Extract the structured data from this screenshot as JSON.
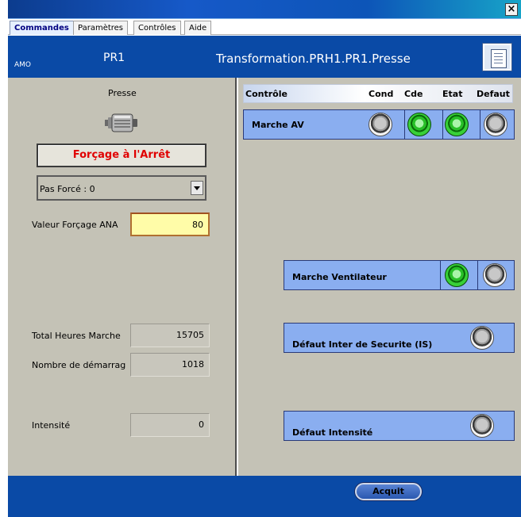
{
  "window": {
    "close_glyph": "×"
  },
  "tabs": [
    {
      "label": "Commandes",
      "active": true
    },
    {
      "label": "Paramètres",
      "active": false
    },
    {
      "label": "Contrôles",
      "active": false
    },
    {
      "label": "Aide",
      "active": false
    }
  ],
  "header": {
    "amo": "AMO",
    "equipment": "PR1",
    "path": "Transformation.PRH1.PR1.Presse",
    "report_icon": "document-icon"
  },
  "left": {
    "title": "Presse",
    "equipment_icon": "motor-icon",
    "force_button": "Forçage à l'Arrêt",
    "force_select": "Pas Forcé : 0",
    "ana_label": "Valeur Forçage ANA",
    "ana_value": "80",
    "total_hours_label": "Total Heures Marche",
    "total_hours_value": "15705",
    "starts_label": "Nombre de démarrag",
    "starts_value": "1018",
    "intensity_label": "Intensité",
    "intensity_value": "0"
  },
  "controls": {
    "headers": {
      "control": "Contrôle",
      "cond": "Cond",
      "cde": "Cde",
      "etat": "Etat",
      "defaut": "Defaut"
    },
    "rows": [
      {
        "label": "Marche AV",
        "cond": "gray",
        "cde": "green",
        "etat": "green",
        "defaut": "gray"
      },
      {
        "label": "Marche Ventilateur",
        "etat": "green",
        "defaut": "gray"
      },
      {
        "label": "Défaut Inter de Securite (IS)",
        "defaut": "gray"
      },
      {
        "label": "Défaut Intensité",
        "defaut": "gray"
      }
    ]
  },
  "footer": {
    "acquit": "Acquit"
  },
  "colors": {
    "header_blue": "#0a4aa6",
    "row_blue": "#8aaef0",
    "force_red": "#e00000"
  }
}
